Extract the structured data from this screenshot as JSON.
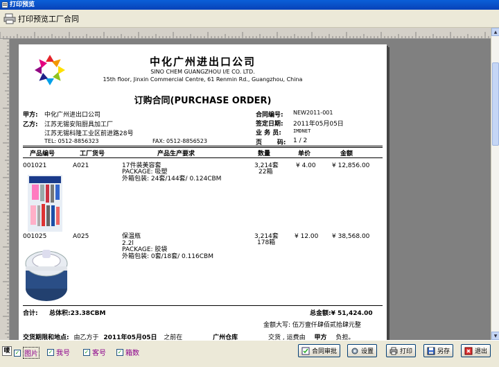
{
  "window": {
    "title": "打印预览"
  },
  "toolbar": {
    "print_preview_label": "打印预览工厂合同"
  },
  "document": {
    "company_cn": "中化广州进出口公司",
    "company_en": "SINO CHEM GUANGZHOU I/E CO. LTD.",
    "company_address": "15th floor, Jinxin Commercial Centre, 61 Renmin Rd., Guangzhou, China",
    "title": "订购合同(PURCHASE ORDER)",
    "party_a_label": "甲方:",
    "party_a": "中化广州进出口公司",
    "party_b_label": "乙方:",
    "party_b": "江苏无锡安阳厨具加工厂",
    "party_b_address": "江苏无锡科隆工业区前进路28号",
    "tel": "TEL: 0512-8856323",
    "fax": "FAX: 0512-8856523",
    "contract_no_label": "合同编号:",
    "contract_no": "NEW2011-001",
    "sign_date_label": "签定日期:",
    "sign_date": "2011年05月05日",
    "salesman_label": "业 务 员:",
    "salesman": "IMDNET",
    "page_label": "页       码:",
    "page": "1 / 2",
    "columns": {
      "product_no": "产品编号",
      "factory_no": "工厂货号",
      "requirements": "产品生产要求",
      "quantity": "数量",
      "unit_price": "单价",
      "amount": "金额"
    },
    "items": [
      {
        "product_no": "001021",
        "factory_no": "A021",
        "req1": "17件装美容套",
        "req2": "PACKAGE: 吸塑",
        "req3": "外箱包装:  24套/144套/ 0.124CBM",
        "qty1": "3,214套",
        "qty2": "22箱",
        "unit_price": "¥ 4.00",
        "amount": "¥ 12,856.00"
      },
      {
        "product_no": "001025",
        "factory_no": "A025",
        "req1": "保温瓶",
        "req2": "2.2l",
        "req3": "PACKAGE: 胶袋",
        "req4": "外箱包装:  0套/18套/ 0.116CBM",
        "qty1": "3,214套",
        "qty2": "178箱",
        "unit_price": "¥ 12.00",
        "amount": "¥ 38,568.00"
      }
    ],
    "total_label": "合计:",
    "total_volume": "总体积:23.38CBM",
    "total_amount": "总金额:¥ 51,424.00",
    "amount_words": "金额大写:  伍万壹仟肆佰贰拾肆元整",
    "delivery_label": "交货期限和地点:",
    "delivery_pre": "由乙方于",
    "delivery_date": "2011年05月05日",
    "delivery_mid": "之前在",
    "delivery_place": "广州仓库",
    "delivery_post": "交货 , 运费由",
    "delivery_party": "甲方",
    "delivery_end": "负担。"
  },
  "statusbar": {
    "toggle": "唛",
    "checks": [
      {
        "label": "图片",
        "checked": true,
        "selected": true
      },
      {
        "label": "我号",
        "checked": true
      },
      {
        "label": "客号",
        "checked": true
      },
      {
        "label": "箱数",
        "checked": true
      }
    ],
    "buttons": {
      "approve": "合同审批",
      "settings": "设置",
      "print": "打印",
      "save_as": "另存",
      "exit": "退出"
    }
  }
}
